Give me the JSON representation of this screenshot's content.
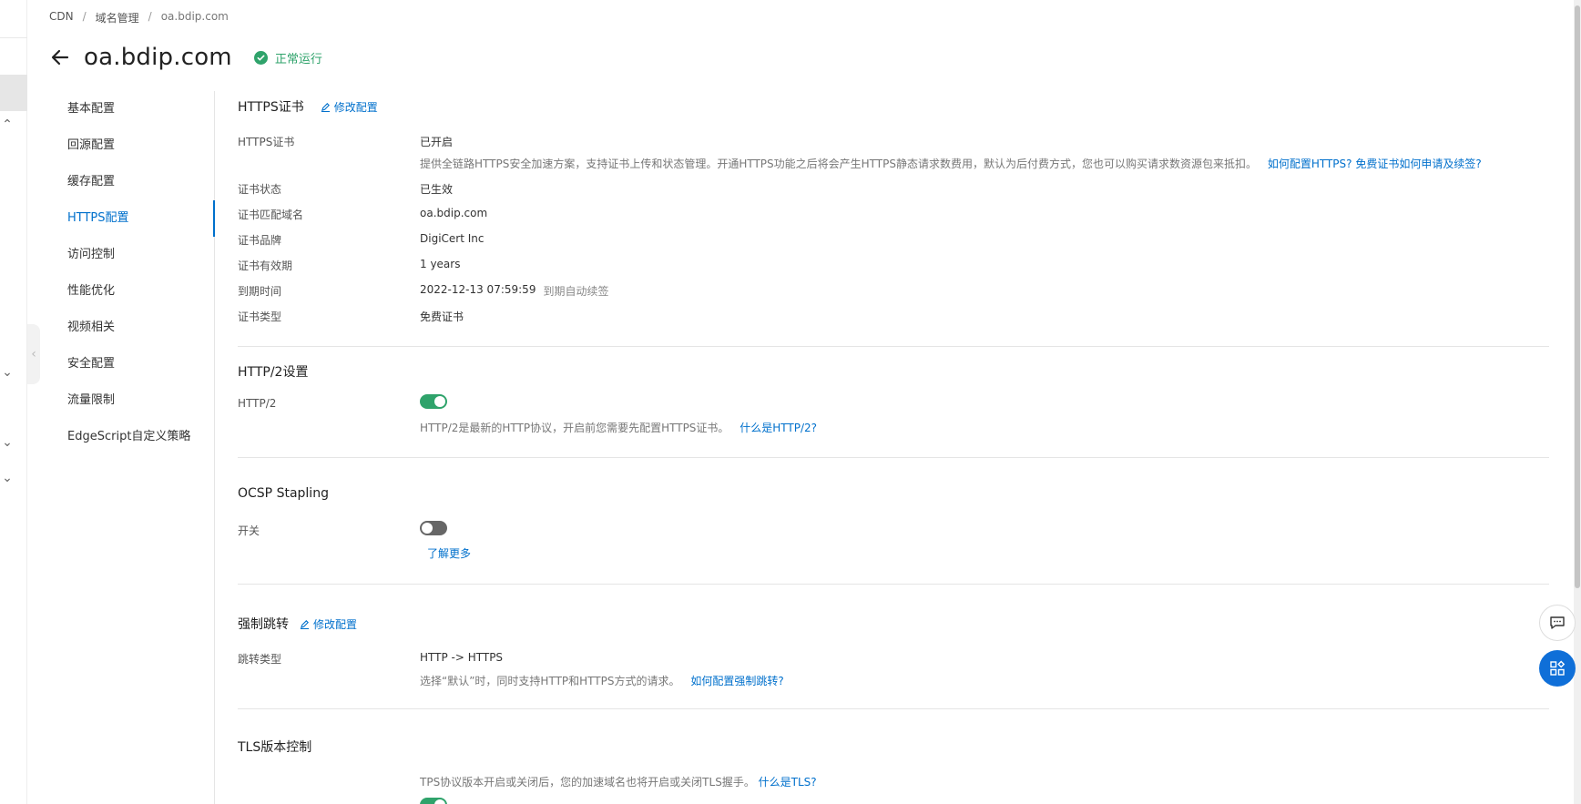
{
  "breadcrumb": {
    "item1": "CDN",
    "item2": "域名管理",
    "item3": "oa.bdip.com",
    "sep": "/"
  },
  "title": "oa.bdip.com",
  "status": "正常运行",
  "sidenav": [
    "基本配置",
    "回源配置",
    "缓存配置",
    "HTTPS配置",
    "访问控制",
    "性能优化",
    "视频相关",
    "安全配置",
    "流量限制",
    "EdgeScript自定义策略"
  ],
  "https": {
    "title": "HTTPS证书",
    "edit": "修改配置",
    "rows": [
      {
        "label": "HTTPS证书",
        "value": "已开启"
      },
      {
        "label": "证书状态",
        "value": "已生效"
      },
      {
        "label": "证书匹配域名",
        "value": "oa.bdip.com"
      },
      {
        "label": "证书品牌",
        "value": "DigiCert Inc"
      },
      {
        "label": "证书有效期",
        "value": "1 years"
      },
      {
        "label": "到期时间",
        "value": "2022-12-13 07:59:59"
      },
      {
        "label": "证书类型",
        "value": "免费证书"
      }
    ],
    "desc": "提供全链路HTTPS安全加速方案，支持证书上传和状态管理。开通HTTPS功能之后将会产生HTTPS静态请求数费用，默认为后付费方式，您也可以购买请求数资源包来抵扣。",
    "desc_link1": "如何配置HTTPS?",
    "desc_link2": "免费证书如何申请及续签?",
    "expire_note": "到期自动续签"
  },
  "http2": {
    "title": "HTTP/2设置",
    "label": "HTTP/2",
    "toggle": "on",
    "desc": "HTTP/2是最新的HTTP协议，开启前您需要先配置HTTPS证书。",
    "link": "什么是HTTP/2?"
  },
  "ocsp": {
    "title": "OCSP Stapling",
    "label": "开关",
    "toggle": "off",
    "link": "了解更多"
  },
  "redirect": {
    "title": "强制跳转",
    "edit": "修改配置",
    "label": "跳转类型",
    "value": "HTTP -> HTTPS",
    "desc": "选择“默认”时，同时支持HTTP和HTTPS方式的请求。",
    "link": "如何配置强制跳转?"
  },
  "tls": {
    "title": "TLS版本控制",
    "desc": "TPS协议版本开启或关闭后，您的加速域名也将开启或关闭TLS握手。",
    "link": "什么是TLS?",
    "toggle": "on"
  },
  "colors": {
    "accent": "#0070cc",
    "success": "#2fa36b"
  }
}
